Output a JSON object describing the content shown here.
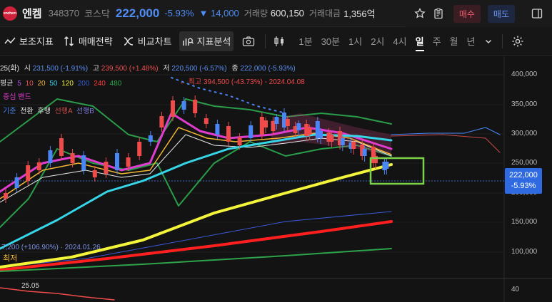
{
  "header": {
    "logo_text": "enchem",
    "name": "엔켐",
    "code": "348370",
    "market": "코스닥",
    "price": "222,000",
    "change_rate": "-5.93%",
    "change_amount": "▼ 14,000",
    "volume_label": "거래량",
    "volume": "600,150",
    "amount_label": "거래대금",
    "amount": "1,356억",
    "buy_label": "매수",
    "sell_label": "매도"
  },
  "toolbar": {
    "tools": [
      "보조지표",
      "매매전략",
      "비교차트",
      "지표분석"
    ],
    "periods": [
      "1분",
      "30분",
      "1시",
      "2시",
      "4시",
      "일",
      "주",
      "월",
      "년"
    ],
    "active_period": "일"
  },
  "legend": {
    "ohlc": {
      "date": "25(화)",
      "open_label": "시",
      "open": "231,500 (-1.91%)",
      "high_label": "고",
      "high": "239,500 (+1.48%)",
      "low_label": "저",
      "low": "220,500 (-6.57%)",
      "close_label": "종",
      "close": "222,000 (-5.93%)"
    },
    "ma_label": "평균",
    "ma_periods": [
      "5",
      "10",
      "20",
      "50",
      "120",
      "200",
      "240",
      "480"
    ],
    "bollinger": "중심 밴드",
    "ichimoku_label": "기준",
    "ichimoku_items": [
      "전환",
      "후행",
      "선행A",
      "선행B"
    ],
    "note_peak": "← 최고 394,500 (-43.73%) - 2024.04.08",
    "note_low": "7,200 (+106.90%) · 2024.01.26",
    "note_low_label": "최저",
    "sub_indicator": "25.05"
  },
  "price_axis": [
    "400,000",
    "350,000",
    "300,000",
    "250,000",
    "200,000",
    "150,000",
    "100,000"
  ],
  "sub_axis": "40",
  "current_tag": {
    "price": "222,000",
    "rate": "-5.93%"
  },
  "colors": {
    "up": "#ef4b4b",
    "down": "#4a86f5",
    "accent": "#4e8df5",
    "ma5": "#f2b633",
    "ma10": "#e03cd0",
    "ma20": "#e8e8e8",
    "ma50": "#35d6e8",
    "ma120": "#f4f43a",
    "ma200": "#3a5ad6",
    "ma240": "#ff1f1f",
    "ma480": "#2da34a",
    "highlight": "#7cd24a"
  }
}
